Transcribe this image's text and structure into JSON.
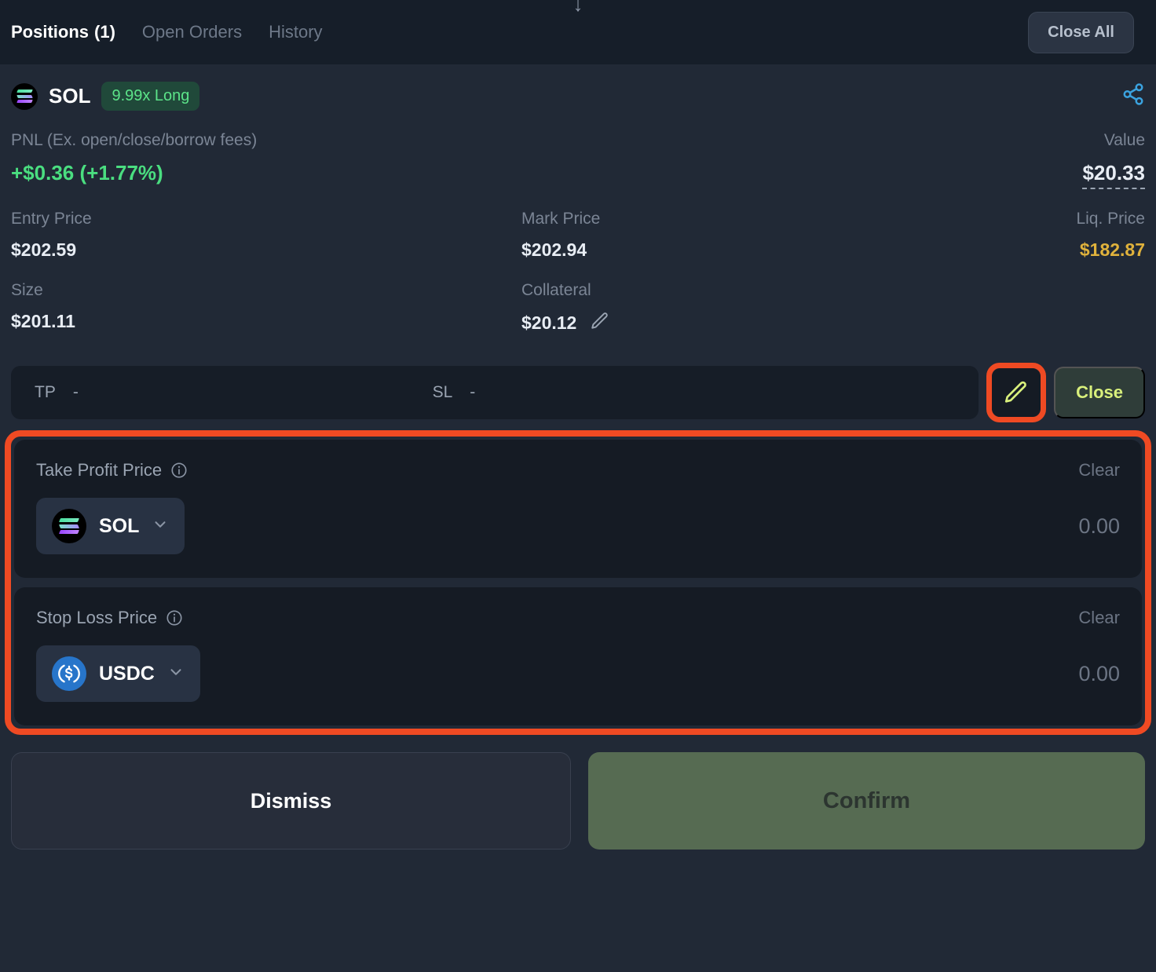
{
  "tabbar": {
    "scroll_arrow_icon": "arrow-down-icon",
    "tabs": [
      {
        "label": "Positions",
        "count": "(1)",
        "active": true
      },
      {
        "label": "Open Orders",
        "count": "",
        "active": false
      },
      {
        "label": "History",
        "count": "",
        "active": false
      }
    ],
    "close_all_label": "Close All"
  },
  "position": {
    "symbol": "SOL",
    "leverage_badge": "9.99x Long",
    "share_icon": "share-icon",
    "pnl_label": "PNL (Ex. open/close/borrow fees)",
    "pnl_value": "+$0.36 (+1.77%)",
    "value_label": "Value",
    "value_value": "$20.33",
    "entry_price_label": "Entry Price",
    "entry_price_value": "$202.59",
    "mark_price_label": "Mark Price",
    "mark_price_value": "$202.94",
    "liq_price_label": "Liq. Price",
    "liq_price_value": "$182.87",
    "size_label": "Size",
    "size_value": "$201.11",
    "collateral_label": "Collateral",
    "collateral_value": "$20.12",
    "collateral_edit_icon": "pencil-icon",
    "tp_label": "TP",
    "tp_value": "-",
    "sl_label": "SL",
    "sl_value": "-",
    "edit_tpsl_icon": "pencil-icon",
    "close_label": "Close"
  },
  "editor": {
    "take_profit": {
      "title": "Take Profit Price",
      "info_icon": "info-circle-icon",
      "clear_label": "Clear",
      "token": "SOL",
      "token_icon": "solana-logo-icon",
      "chevron_icon": "chevron-down-icon",
      "amount": "0.00"
    },
    "stop_loss": {
      "title": "Stop Loss Price",
      "info_icon": "info-circle-icon",
      "clear_label": "Clear",
      "token": "USDC",
      "token_icon": "usdc-logo-icon",
      "chevron_icon": "chevron-down-icon",
      "amount": "0.00"
    }
  },
  "footer": {
    "dismiss_label": "Dismiss",
    "confirm_label": "Confirm"
  },
  "colors": {
    "accent_highlight": "#ef4a23",
    "positive": "#4ade80",
    "warning": "#e0b23c",
    "lime": "#d9f07c",
    "background": "#212936",
    "panel": "#151b24"
  }
}
